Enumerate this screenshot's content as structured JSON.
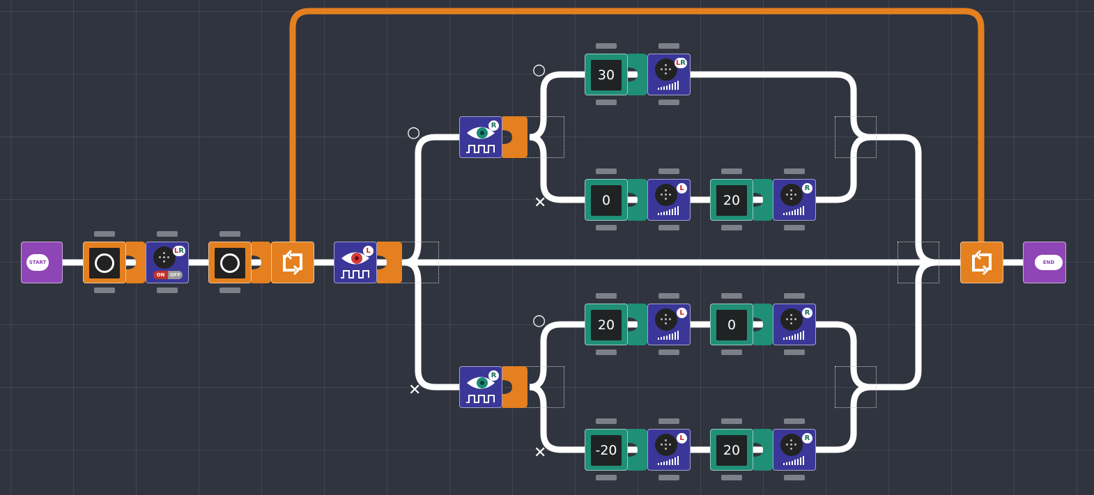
{
  "terminals": {
    "start": "START",
    "end": "END"
  },
  "toggle": {
    "on": "ON",
    "off": "OFF"
  },
  "branch_marks": {
    "true": "○",
    "false": "✕"
  },
  "sensors": {
    "main": "L",
    "upper": "R",
    "lower": "R"
  },
  "motors": {
    "both": "LR",
    "left": "L",
    "right": "R"
  },
  "speeds": {
    "up_true_both": "30",
    "up_false_left": "0",
    "up_false_right": "20",
    "low_true_left": "20",
    "low_true_right": "0",
    "low_false_left": "-20",
    "low_false_right": "20"
  },
  "colors": {
    "background": "#30343e",
    "wire": "#ffffff",
    "loop_wire": "#e4801f",
    "terminal": "#8e45b6",
    "control_block": "#e4801f",
    "number_block": "#1f8f76",
    "device_block": "#3a3799"
  }
}
